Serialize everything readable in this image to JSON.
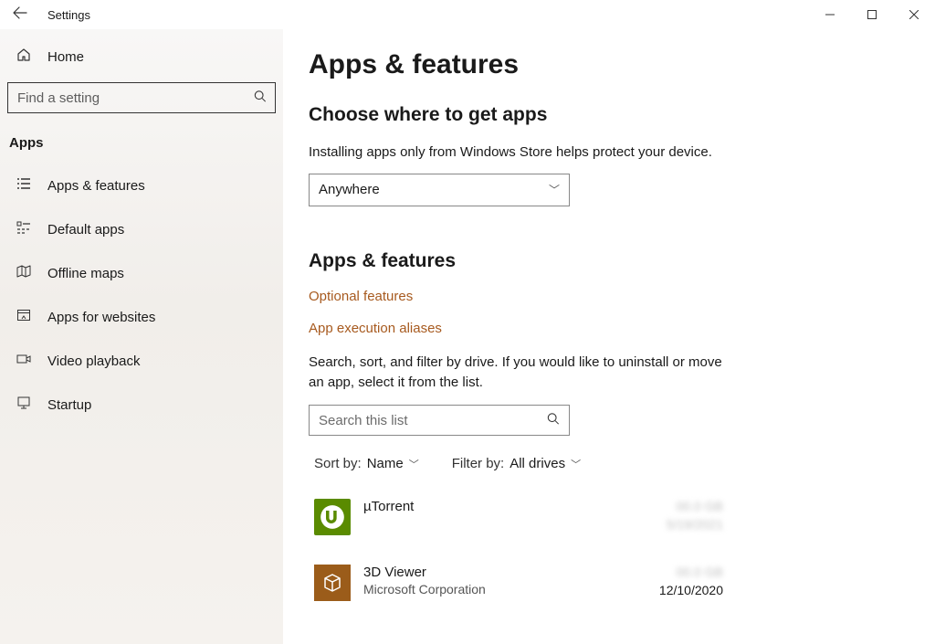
{
  "window": {
    "title": "Settings"
  },
  "sidebar": {
    "home_label": "Home",
    "search_placeholder": "Find a setting",
    "category": "Apps",
    "items": [
      {
        "icon": "list",
        "label": "Apps & features"
      },
      {
        "icon": "defaults",
        "label": "Default apps"
      },
      {
        "icon": "map",
        "label": "Offline maps"
      },
      {
        "icon": "website",
        "label": "Apps for websites"
      },
      {
        "icon": "video",
        "label": "Video playback"
      },
      {
        "icon": "startup",
        "label": "Startup"
      }
    ]
  },
  "main": {
    "title": "Apps & features",
    "source_heading": "Choose where to get apps",
    "source_desc": "Installing apps only from Windows Store helps protect your device.",
    "source_value": "Anywhere",
    "list_heading": "Apps & features",
    "link_optional": "Optional features",
    "link_aliases": "App execution aliases",
    "list_desc": "Search, sort, and filter by drive. If you would like to uninstall or move an app, select it from the list.",
    "list_search_placeholder": "Search this list",
    "sort_label": "Sort by:",
    "sort_value": "Name",
    "filter_label": "Filter by:",
    "filter_value": "All drives",
    "apps": [
      {
        "name": "µTorrent",
        "publisher": "",
        "size": "00.0 GB",
        "date": "5/19/2021",
        "date_blur": true
      },
      {
        "name": "3D Viewer",
        "publisher": "Microsoft Corporation",
        "size": "00.0 GB",
        "date": "12/10/2020",
        "date_blur": false
      }
    ]
  }
}
